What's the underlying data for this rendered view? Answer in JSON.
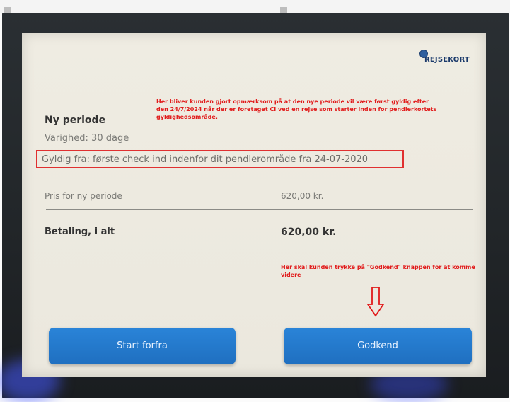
{
  "logo": {
    "text": "REJSEKORT"
  },
  "annotations": {
    "note1": "Her bliver kunden gjort opmærksom på at den nye periode vil være først gyldig efter den 24/7/2024 når der er foretaget CI ved en rejse som starter inden for pendlerkortets gyldighedsområde.",
    "note2": "Her skal kunden trykke på \"Godkend\" knappen for at komme videre"
  },
  "period": {
    "title": "Ny periode",
    "duration": "Varighed: 30 dage",
    "valid_from": "Gyldig fra: første check ind indenfor dit pendlerområde fra 24-07-2020"
  },
  "price": {
    "label": "Pris for ny periode",
    "value": "620,00 kr."
  },
  "total": {
    "label": "Betaling, i alt",
    "value": "620,00 kr."
  },
  "buttons": {
    "restart": "Start forfra",
    "approve": "Godkend"
  },
  "colors": {
    "button": "#1f6fc0",
    "annotation": "#e11b1b",
    "screen": "#edeae0"
  }
}
